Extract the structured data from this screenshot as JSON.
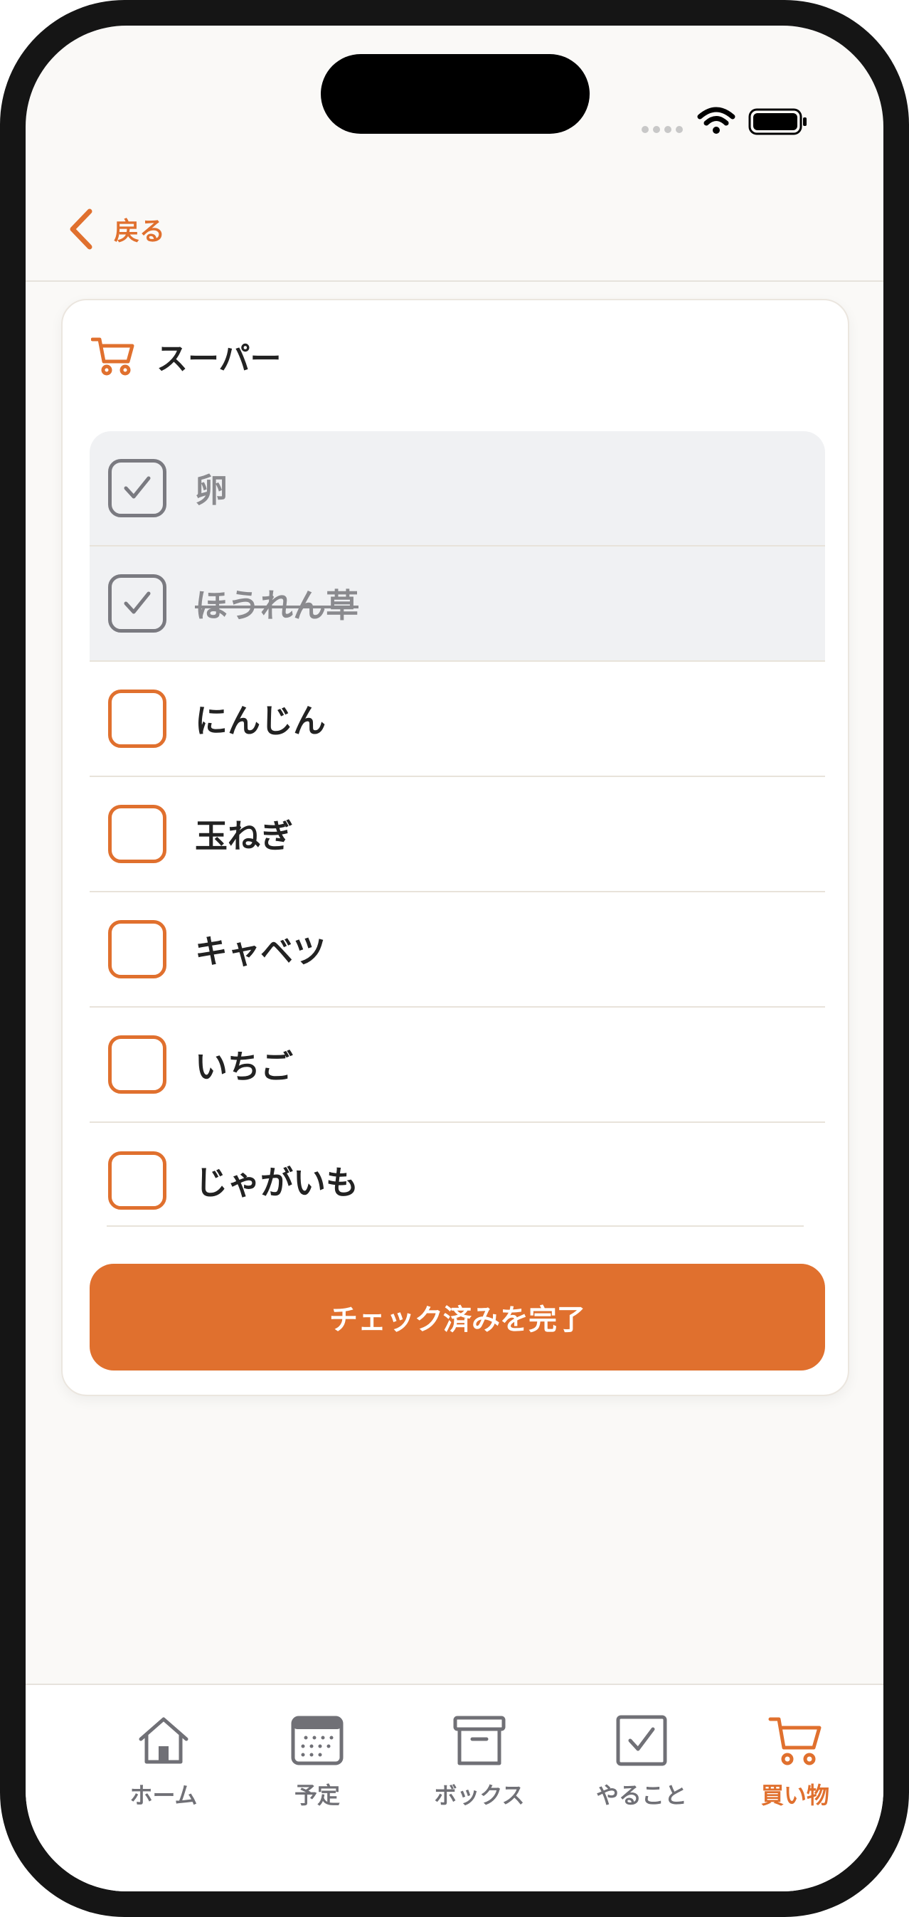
{
  "navigation": {
    "back_label": "戻る"
  },
  "list": {
    "title": "スーパー",
    "title_icon": "cart-icon",
    "items": [
      {
        "label": "卵",
        "checked": true,
        "strikethrough": false
      },
      {
        "label": "ほうれん草",
        "checked": true,
        "strikethrough": true
      },
      {
        "label": "にんじん",
        "checked": false,
        "strikethrough": false
      },
      {
        "label": "玉ねぎ",
        "checked": false,
        "strikethrough": false
      },
      {
        "label": "キャベツ",
        "checked": false,
        "strikethrough": false
      },
      {
        "label": "いちご",
        "checked": false,
        "strikethrough": false
      },
      {
        "label": "じゃがいも",
        "checked": false,
        "strikethrough": false
      }
    ],
    "complete_button_label": "チェック済みを完了"
  },
  "tabbar": {
    "tabs": [
      {
        "label": "ホーム",
        "icon": "house-icon",
        "active": false
      },
      {
        "label": "予定",
        "icon": "calendar-icon",
        "active": false
      },
      {
        "label": "ボックス",
        "icon": "archive-box-icon",
        "active": false
      },
      {
        "label": "やること",
        "icon": "checkbox-icon",
        "active": false
      },
      {
        "label": "買い物",
        "icon": "cart-icon",
        "active": true
      }
    ]
  },
  "colors": {
    "accent": "#e0702e",
    "text": "#222222",
    "muted": "#707076",
    "background": "#faf9f7"
  }
}
